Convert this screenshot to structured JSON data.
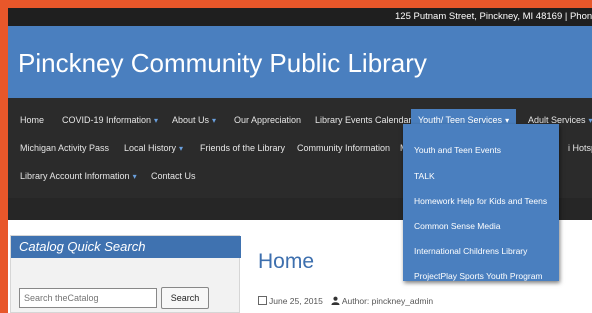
{
  "topbar": {
    "address": "125 Putnam Street, Pinckney, MI 48169 | Phone: ("
  },
  "header": {
    "title": "Pinckney Community Public Library"
  },
  "nav": {
    "home": "Home",
    "covid": "COVID-19 Information",
    "about": "About Us",
    "appreciation": "Our Appreciation",
    "events_calendar": "Library Events Calendar",
    "youth": "Youth/ Teen Services",
    "adult": "Adult Services",
    "michigan_pass": "Michigan Activity Pass",
    "local_history": "Local History",
    "friends": "Friends of the Library",
    "community": "Community Information",
    "partial_mo": "Mo",
    "partial_hotspot": "i Hotsp",
    "account": "Library Account Information",
    "contact": "Contact Us"
  },
  "dropdown": {
    "items": [
      "Youth and Teen Events",
      "TALK",
      "Homework Help for Kids and Teens",
      "Common Sense Media",
      "International Childrens Library",
      "ProjectPlay Sports Youth Program"
    ]
  },
  "sidebar": {
    "heading": "Catalog Quick Search",
    "search_placeholder": "Search theCatalog",
    "search_button": "Search"
  },
  "main": {
    "title": "Home",
    "date": "June 25, 2015",
    "author": "Author: pinckney_admin"
  },
  "colors": {
    "accent": "#4a7fbf",
    "border": "#e8572a",
    "nav_bg": "#2b2b2b"
  },
  "icons": {
    "calendar": "calendar-icon",
    "user": "user-icon",
    "caret": "caret-down-icon"
  }
}
